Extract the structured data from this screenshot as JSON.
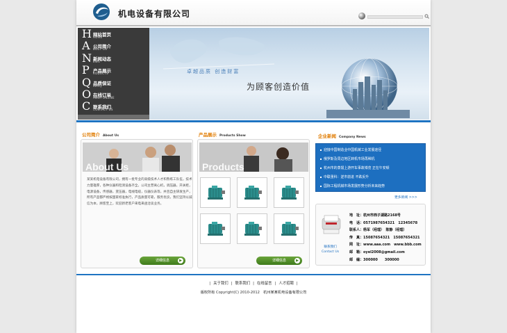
{
  "header": {
    "company_name": "机电设备有限公司"
  },
  "nav": [
    {
      "letter": "H",
      "cn": "网站首页",
      "en": "HOME"
    },
    {
      "letter": "A",
      "cn": "公司简介",
      "en": "BOUT US"
    },
    {
      "letter": "N",
      "cn": "新闻动态",
      "en": "EWS"
    },
    {
      "letter": "P",
      "cn": "产品展示",
      "en": "RODUCTS"
    },
    {
      "letter": "Q",
      "cn": "品质保证",
      "en": "uality"
    },
    {
      "letter": "O",
      "cn": "在线订单",
      "en": "RDER ONLINE"
    },
    {
      "letter": "C",
      "cn": "联系我们",
      "en": "CONTACT US"
    }
  ],
  "banner": {
    "slogan_small": "卓越品质 创造财富",
    "slogan_big": "为顾客创造价值"
  },
  "about": {
    "title": "公司简介",
    "title_en": "About Us",
    "photo_caption": "About Us",
    "text": "某某机电设备有限公司，拥有一批专业的高级技术人才和熟练工队伍，技术力量雄厚，各种仪器和检测设备齐全。公司主营离心机，调压器，开关柜，电源设备，传感器，变压器，电线电缆，仪器仪表等，并且自主研发生产，所有产品都严格按国家标准执行，产品质量可靠，服务优良，我们坚持以诚信为本，顾客至上，欢迎新老客户来电来函洽谈业务。",
    "button": "详细信息"
  },
  "products": {
    "title": "产品展示",
    "title_en": "Products Show",
    "photo_caption": "Products",
    "button": "详细信息"
  },
  "news": {
    "title": "企业新闻",
    "title_en": "Company News",
    "items": [
      "迎接中国制造业中国机械工业发展途径",
      "俄罗斯及周边地区转机市场再稀机",
      "杭州市的蒸馏上游开车事故博览 正在午安顿",
      "中联重科：逆市前进 不跌反升",
      "国际工程机械市场发展形势分析未来趋势"
    ],
    "more": "更多新闻 >>>"
  },
  "contact": {
    "label_cn": "联系我们",
    "label_en": "Contact Us",
    "lines": [
      "地　址：杭州市西子湖路2168号",
      "电　话：0571987654321　12345678",
      "联系人：杨军（经理）　陈静（经理）",
      "传　真：15087654321　15087654321",
      "网　址：www.aaa.com　www.bbb.com",
      "邮　箱：oyel2008@gmail.com",
      "邮　编：300000　　300000"
    ]
  },
  "footer": {
    "links": [
      "关于我们",
      "联系我们",
      "在线留言",
      "人才招聘"
    ],
    "copyright": "版权所有 Copyright(C) 2010-2012　杭州某某机电设备有限公司"
  },
  "colors": {
    "accent_blue": "#1e74c2",
    "title_orange": "#e07b00",
    "button_green": "#4f8d2a",
    "nav_bg": "#3a3a3a"
  }
}
